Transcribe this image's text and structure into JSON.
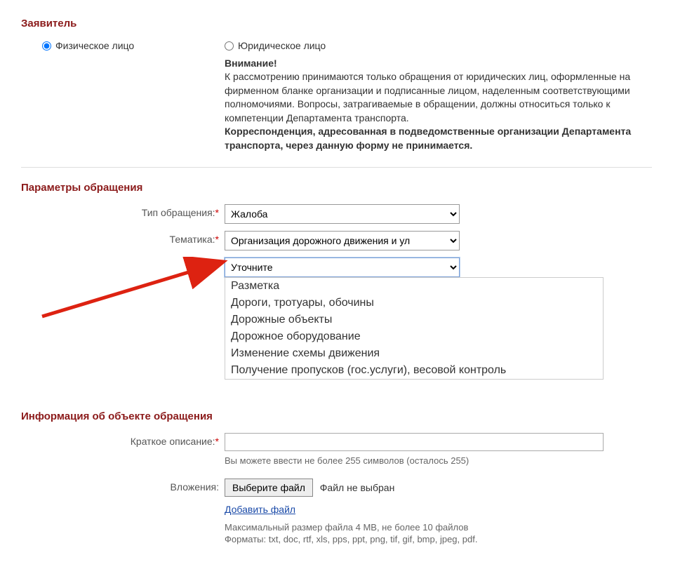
{
  "sections": {
    "applicant": "Заявитель",
    "params": "Параметры обращения",
    "info": "Информация об объекте обращения"
  },
  "applicant": {
    "individual": "Физическое лицо",
    "legal": "Юридическое лицо",
    "attention_title": "Внимание!",
    "attention_p1": "К рассмотрению принимаются только обращения от юридических лиц, оформленные на фирменном бланке организации и подписанные лицом, наделенным соответствующими полномочиями. Вопросы, затрагиваемые в обращении, должны относиться только к компетенции Департамента транспорта.",
    "attention_p2": "Корреспонденция, адресованная в подведомственные организации Департамента транспорта, через данную форму не принимается."
  },
  "params": {
    "type_label": "Тип обращения:",
    "type_value": "Жалоба",
    "topic_label": "Тематика:",
    "topic_value": "Организация дорожного движения и ул",
    "refine_value": "Уточните",
    "options": [
      "Разметка",
      "Дороги, тротуары, обочины",
      "Дорожные объекты",
      "Дорожное оборудование",
      "Изменение схемы движения",
      "Получение пропусков (гос.услуги), весовой контроль"
    ]
  },
  "info": {
    "desc_label": "Краткое описание:",
    "desc_hint": "Вы можете ввести не более 255 символов (осталось 255)",
    "attach_label": "Вложения:",
    "file_btn": "Выберите файл",
    "file_none": "Файл не выбран",
    "add_file": "Добавить файл",
    "size_hint": "Максимальный размер файла 4 MB, не более 10 файлов",
    "format_hint": "Форматы: txt, doc, rtf, xls, pps, ppt, png, tif, gif, bmp, jpeg, pdf."
  }
}
